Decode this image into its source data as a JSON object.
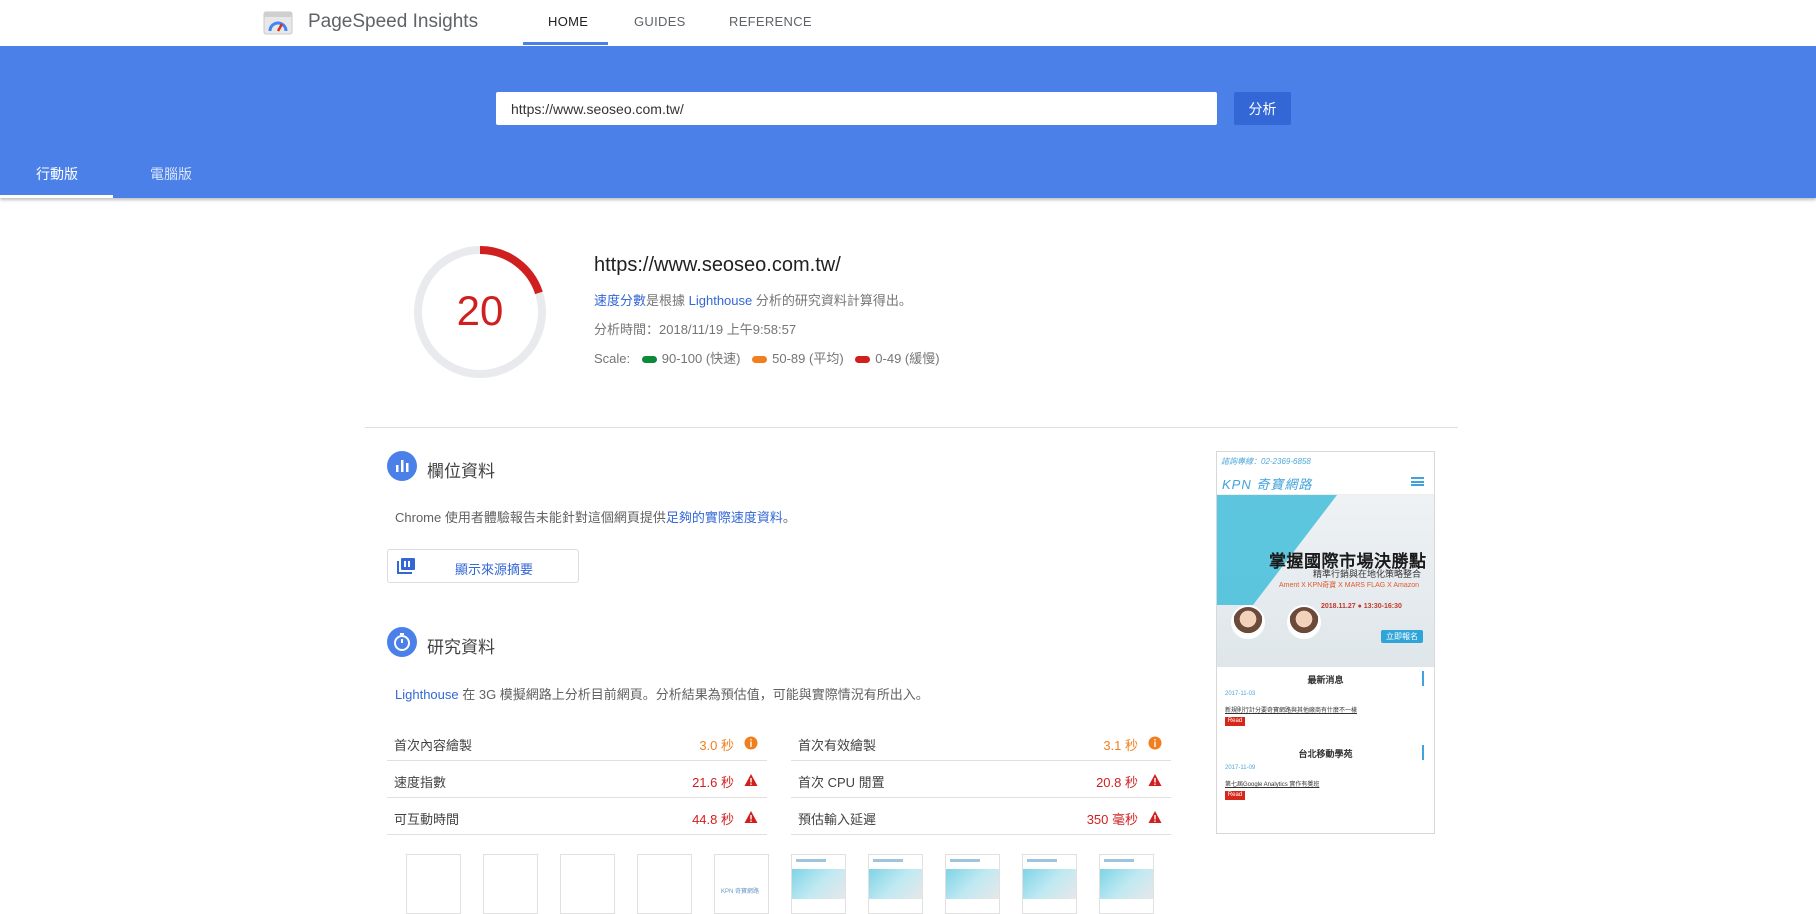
{
  "app": {
    "title": "PageSpeed Insights"
  },
  "nav": {
    "tabs": [
      {
        "label": "HOME",
        "active": true
      },
      {
        "label": "GUIDES"
      },
      {
        "label": "REFERENCE"
      }
    ]
  },
  "search": {
    "url": "https://www.seoseo.com.tw/",
    "button_label": "分析"
  },
  "device_tabs": [
    {
      "label": "行動版",
      "active": true
    },
    {
      "label": "電腦版"
    }
  ],
  "summary": {
    "score": "20",
    "score_fraction": 0.2,
    "url": "https://www.seoseo.com.tw/",
    "desc_link": "速度分數",
    "desc_mid": "是根據 ",
    "desc_link2": "Lighthouse",
    "desc_end": " 分析的研究資料計算得出。",
    "time": "分析時間：2018/11/19 上午9:58:57",
    "scale_label": "Scale:",
    "scale": [
      {
        "label": "90-100 (快速)",
        "color": "#0c8a3a"
      },
      {
        "label": "50-89 (平均)",
        "color": "#f17f1e"
      },
      {
        "label": "0-49 (緩慢)",
        "color": "#d01f1f"
      }
    ]
  },
  "field_data": {
    "icon": "bar-chart-icon",
    "title": "欄位資料",
    "text": "Chrome 使用者體驗報告未能針對這個網頁提供",
    "link": "足夠的實際速度資料",
    "text_end": "。",
    "button_label": "顯示來源摘要"
  },
  "lab_data": {
    "icon": "stopwatch-icon",
    "title": "研究資料",
    "link": "Lighthouse",
    "text": " 在 3G 模擬網路上分析目前網頁。分析結果為預估值，可能與實際情況有所出入。",
    "metrics": [
      {
        "label": "首次內容繪製",
        "value": "3.0 秒",
        "status": "average",
        "icon": "info-circle-icon"
      },
      {
        "label": "首次有效繪製",
        "value": "3.1 秒",
        "status": "average",
        "icon": "info-circle-icon"
      },
      {
        "label": "速度指數",
        "value": "21.6 秒",
        "status": "slow",
        "icon": "warning-triangle-icon"
      },
      {
        "label": "首次 CPU 閒置",
        "value": "20.8 秒",
        "status": "slow",
        "icon": "warning-triangle-icon"
      },
      {
        "label": "可互動時間",
        "value": "44.8 秒",
        "status": "slow",
        "icon": "warning-triangle-icon"
      },
      {
        "label": "預估輸入延遲",
        "value": "350 毫秒",
        "status": "slow",
        "icon": "warning-triangle-icon"
      }
    ],
    "filmstrip_thumb_text": "KPN 奇寶網路"
  },
  "preview": {
    "topbar": "諮詢專線：02-2369-6858",
    "brand": "KPN 奇寶網路",
    "headline": "掌握國際市場決勝點",
    "subhead": "精準行銷與在地化策略整合",
    "subhead2": "Ament X KPN奇寶 X MARS FLAG X Amazon",
    "date": "2018.11.27 ● 13:30-16:30",
    "register": "立即報名",
    "section1": "最新消息",
    "news1_date": "2017-11-03",
    "news1_title": "新規則行計分要奇寶網路與其他廠商有什麼不一樣",
    "read": "Read",
    "section2": "台北移動學苑",
    "news2_date": "2017-11-09",
    "news2_title": "第七屆Google Analytics 實作有獎班"
  },
  "colors": {
    "accent": "#4b80e9",
    "average": "#f17f1e",
    "slow": "#d01f1f",
    "link": "#3367d6"
  }
}
